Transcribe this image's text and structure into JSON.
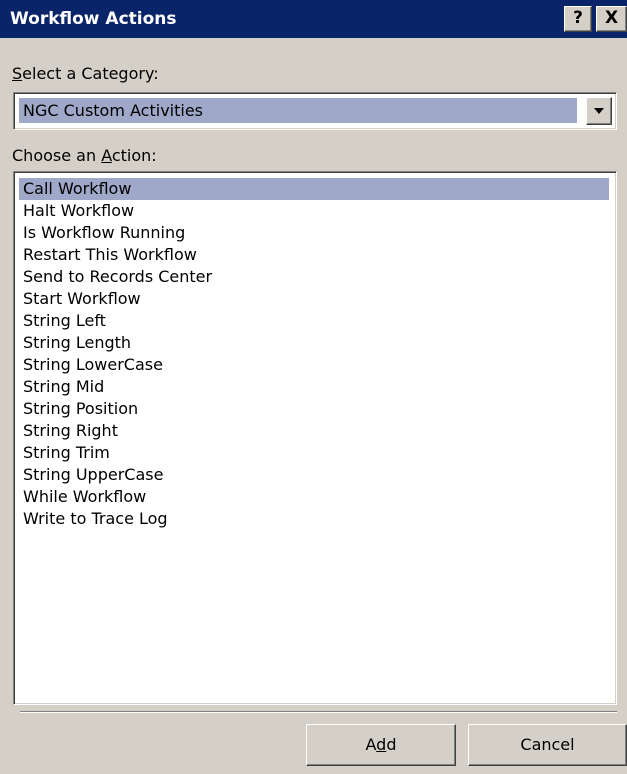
{
  "window": {
    "title": "Workflow Actions",
    "help_label": "?",
    "close_label": "X"
  },
  "category": {
    "label_mnemonic": "S",
    "label_rest": "elect a Category:",
    "selected_value": "NGC Custom Activities",
    "dropdown_icon": "chevron-down-icon"
  },
  "action": {
    "label_pre": "Choose an ",
    "label_mnemonic": "A",
    "label_rest": "ction:",
    "selected_index": 0,
    "items": [
      "Call Workflow",
      "Halt Workflow",
      "Is Workflow Running",
      "Restart This Workflow",
      "Send to Records Center",
      "Start Workflow",
      "String Left",
      "String Length",
      "String LowerCase",
      "String Mid",
      "String Position",
      "String Right",
      "String Trim",
      "String UpperCase",
      "While Workflow",
      "Write to Trace Log"
    ]
  },
  "buttons": {
    "add_pre": "A",
    "add_mnemonic": "d",
    "add_rest": "d",
    "cancel": "Cancel"
  },
  "colors": {
    "titlebar": "#0a246a",
    "face": "#d4d0c8",
    "selection": "#9fa8c8"
  }
}
